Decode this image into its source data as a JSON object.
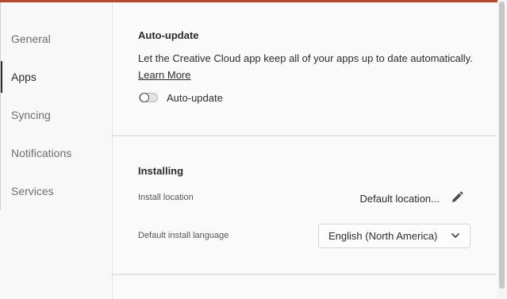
{
  "sidebar": {
    "items": [
      {
        "label": "General",
        "selected": false
      },
      {
        "label": "Apps",
        "selected": true
      },
      {
        "label": "Syncing",
        "selected": false
      },
      {
        "label": "Notifications",
        "selected": false
      },
      {
        "label": "Services",
        "selected": false
      }
    ]
  },
  "auto_update": {
    "title": "Auto-update",
    "description": "Let the Creative Cloud app keep all of your apps up to date automatically.",
    "learn_more": "Learn More",
    "toggle_label": "Auto-update",
    "toggle_on": false
  },
  "installing": {
    "title": "Installing",
    "location_label": "Install location",
    "location_value": "Default location...",
    "language_label": "Default install language",
    "language_value": "English (North America)"
  },
  "icons": {
    "edit": "pencil-icon",
    "dropdown": "chevron-down-icon"
  },
  "colors": {
    "accent_top": "#b84a2e",
    "text": "#2c2c2c",
    "muted": "#6e6e6e"
  }
}
